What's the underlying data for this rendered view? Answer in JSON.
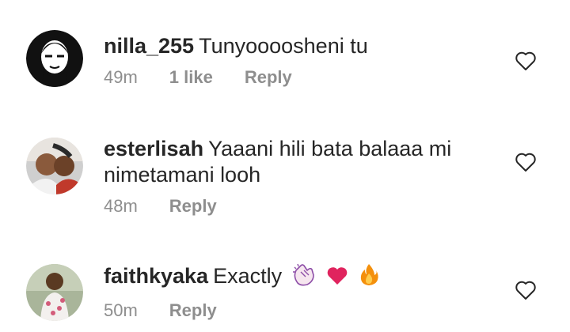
{
  "comments": [
    {
      "username": "nilla_255",
      "text": "Tunyoooosheni tu",
      "time": "49m",
      "likes": "1 like",
      "reply": "Reply",
      "avatar_icon": "black-white-cartoon-face-avatar",
      "like_icon": "heart-outline-icon"
    },
    {
      "username": "esterlisah",
      "text": "Yaaani hili bata balaaa  mi nimetamani looh",
      "time": "48m",
      "reply": "Reply",
      "avatar_icon": "couple-photo-avatar",
      "like_icon": "heart-outline-icon"
    },
    {
      "username": "faithkyaka",
      "text": "Exactly",
      "emojis": [
        "clapping-hands-emoji",
        "red-heart-emoji",
        "fire-emoji"
      ],
      "time": "50m",
      "reply": "Reply",
      "avatar_icon": "person-photo-avatar",
      "like_icon": "heart-outline-icon"
    }
  ]
}
